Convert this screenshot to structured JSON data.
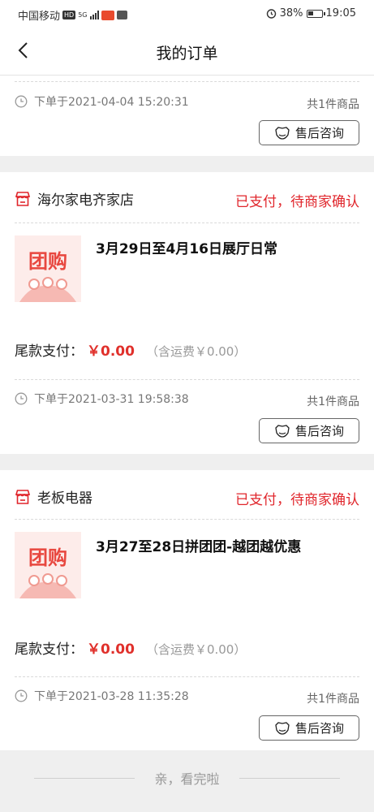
{
  "statusbar": {
    "carrier": "中国移动",
    "hd_badge": "HD",
    "network": "5G",
    "battery": "38%",
    "time": "19:05",
    "alarm_icon": "alarm-icon"
  },
  "header": {
    "title": "我的订单",
    "back_icon": "back-arrow-icon"
  },
  "orders": [
    {
      "order_time": "下单于2021-04-04 15:20:31",
      "item_count": "共1件商品",
      "aftersale_label": "售后咨询"
    },
    {
      "store": "海尔家电齐家店",
      "status": "已支付，待商家确认",
      "product_title": "3月29日至4月16日展厅日常",
      "thumb_text": "团购",
      "pay_label": "尾款支付：",
      "pay_amount": "￥0.00",
      "shipping": "（含运费￥0.00）",
      "order_time": "下单于2021-03-31 19:58:38",
      "item_count": "共1件商品",
      "aftersale_label": "售后咨询"
    },
    {
      "store": "老板电器",
      "status": "已支付，待商家确认",
      "product_title": "3月27至28日拼团团-越团越优惠",
      "thumb_text": "团购",
      "pay_label": "尾款支付：",
      "pay_amount": "￥0.00",
      "shipping": "（含运费￥0.00）",
      "order_time": "下单于2021-03-28 11:35:28",
      "item_count": "共1件商品",
      "aftersale_label": "售后咨询"
    }
  ],
  "footer": {
    "end_text": "亲，看完啦"
  },
  "colors": {
    "accent_red": "#e0252b",
    "price_red": "#e0302b",
    "background": "#efefef"
  }
}
